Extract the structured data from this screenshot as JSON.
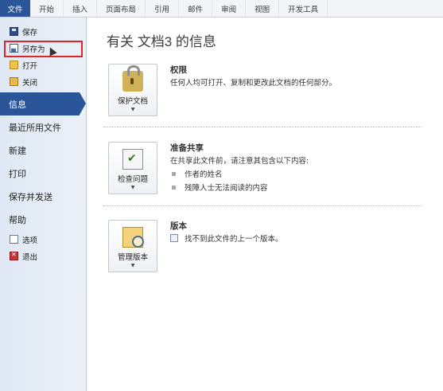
{
  "ribbon": {
    "tabs": [
      "文件",
      "开始",
      "插入",
      "页面布局",
      "引用",
      "邮件",
      "审阅",
      "视图",
      "开发工具"
    ]
  },
  "nav": {
    "save": "保存",
    "save_as": "另存为",
    "open": "打开",
    "close": "关闭",
    "info": "信息",
    "recent": "最近所用文件",
    "new": "新建",
    "print": "打印",
    "save_send": "保存并发送",
    "help": "帮助",
    "options": "选项",
    "exit": "退出"
  },
  "main": {
    "title": "有关 文档3 的信息",
    "permissions": {
      "button": "保护文档",
      "title": "权限",
      "desc": "任何人均可打开、复制和更改此文档的任何部分。"
    },
    "prepare": {
      "button": "检查问题",
      "title": "准备共享",
      "desc": "在共享此文件前，请注意其包含以下内容:",
      "items": [
        "作者的姓名",
        "残障人士无法阅读的内容"
      ]
    },
    "versions": {
      "button": "管理版本",
      "title": "版本",
      "desc": "找不到此文件的上一个版本。"
    }
  },
  "colors": {
    "accent": "#2a5699",
    "highlight": "#e0242a"
  }
}
